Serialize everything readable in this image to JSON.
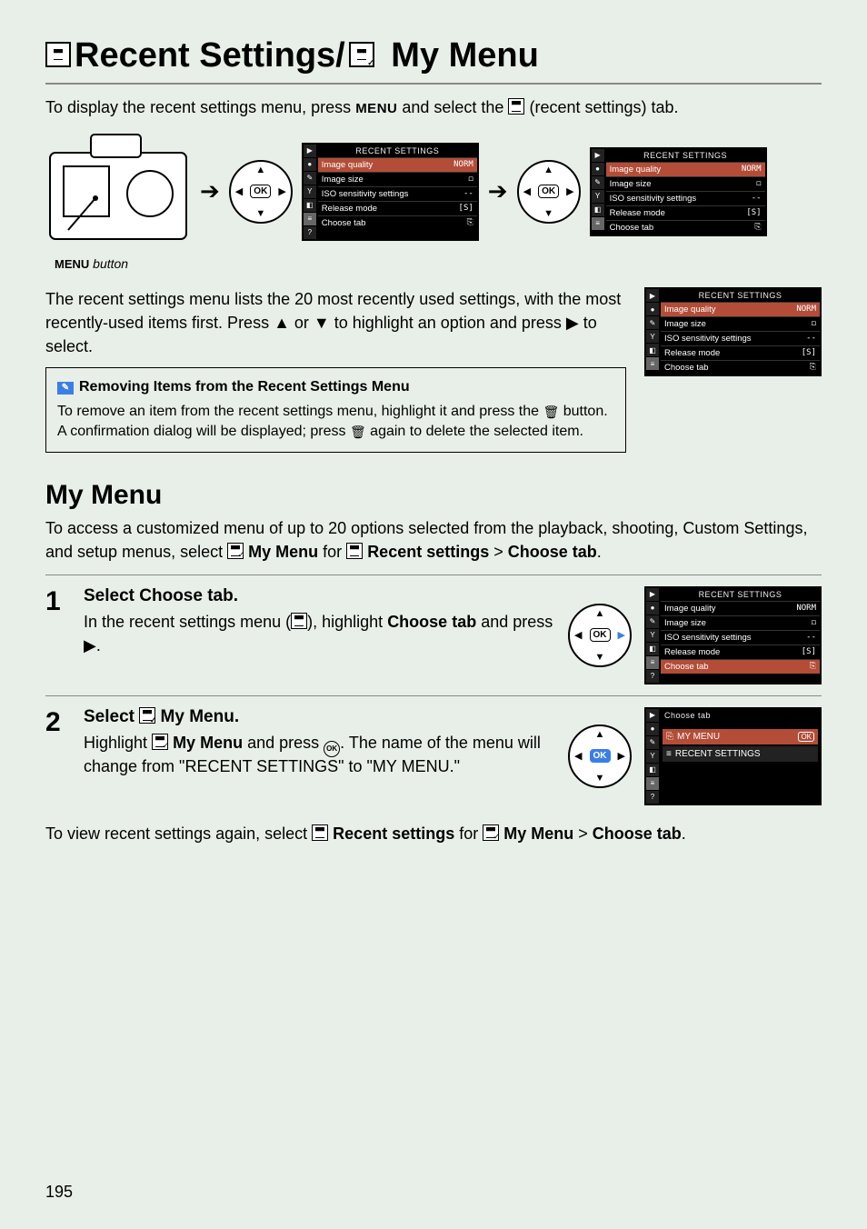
{
  "page_number": "195",
  "title_part1": "Recent Settings/",
  "title_part2": "My Menu",
  "intro_a": "To display the recent settings menu, press ",
  "intro_menu_btn": "MENU",
  "intro_b": " and select the ",
  "intro_c": " (recent settings) tab.",
  "menu_button_caption_btn": "MENU",
  "menu_button_caption": " button",
  "lcd_header": "RECENT SETTINGS",
  "lcd_rows": [
    {
      "label": "Image quality",
      "value": "NORM"
    },
    {
      "label": "Image size",
      "value": "◻"
    },
    {
      "label": "ISO sensitivity settings",
      "value": "--"
    },
    {
      "label": "Release mode",
      "value": "[S]"
    },
    {
      "label": "Choose tab",
      "value": "⎘"
    }
  ],
  "para1": "The recent settings menu lists the 20 most recently used settings, with the most recently-used items first. Press ▲ or ▼ to highlight an option and press ▶ to select.",
  "note_title": "Removing Items from the Recent Settings Menu",
  "note_body_a": "To remove an item from the recent settings menu, highlight it and press the ",
  "note_body_b": " button. A confirmation dialog will be displayed; press ",
  "note_body_c": " again to delete the selected item.",
  "my_menu_heading": "My Menu",
  "my_menu_intro_a": "To access a customized menu of up to 20 options selected from the playback, shooting, Custom Settings, and setup menus, select ",
  "my_menu_intro_mm": "My Menu",
  "my_menu_intro_b": " for ",
  "my_menu_intro_rs": "Recent settings",
  "my_menu_intro_c": " > ",
  "my_menu_intro_ct": "Choose tab",
  "my_menu_intro_d": ".",
  "step1_num": "1",
  "step1_title_a": "Select ",
  "step1_title_b": "Choose tab.",
  "step1_body_a": "In the recent settings menu (",
  "step1_body_b": "), highlight ",
  "step1_body_ct": "Choose tab",
  "step1_body_c": " and press ▶.",
  "step2_num": "2",
  "step2_title_a": "Select ",
  "step2_title_b": "My Menu.",
  "step2_body_a": "Highlight ",
  "step2_body_mm": "My Menu",
  "step2_body_b": " and press ",
  "step2_body_c": ". The name of the menu will change from \"RECENT SETTINGS\" to \"MY MENU.\"",
  "choose_tab_header": "Choose tab",
  "choose_opts": [
    "MY MENU",
    "RECENT SETTINGS"
  ],
  "closing_a": "To view recent settings again, select ",
  "closing_rs": "Recent settings",
  "closing_b": " for ",
  "closing_mm": "My Menu",
  "closing_c": " > ",
  "closing_ct": "Choose tab",
  "closing_d": "."
}
